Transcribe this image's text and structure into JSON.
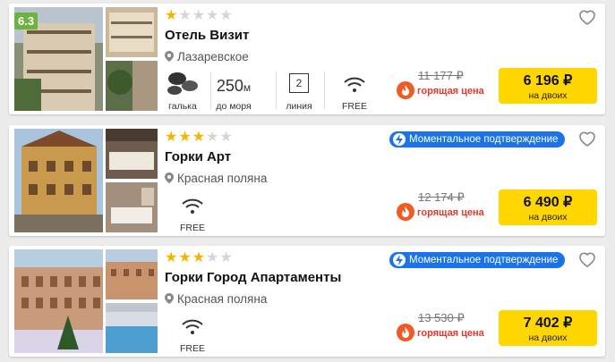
{
  "hotels": [
    {
      "rating_badge": "6.3",
      "stars": 1,
      "name": "Отель Визит",
      "location": "Лазаревское",
      "amenities": {
        "beach": "галька",
        "distance_value": "250",
        "distance_unit": "м",
        "distance_label": "до моря",
        "line_number": "2",
        "line_label": "линия",
        "wifi_label": "FREE"
      },
      "confirm_badge": "",
      "old_price": "11 177 ₽",
      "hot_label": "горящая цена",
      "price": "6 196 ₽",
      "price_sub": "на двоих"
    },
    {
      "rating_badge": "",
      "stars": 3,
      "name": "Горки Арт",
      "location": "Красная поляна",
      "amenities": {
        "wifi_label": "FREE"
      },
      "confirm_badge": "Моментальное подтверждение",
      "old_price": "12 174 ₽",
      "hot_label": "горящая цена",
      "price": "6 490 ₽",
      "price_sub": "на двоих"
    },
    {
      "rating_badge": "",
      "stars": 3,
      "name": "Горки Город Апартаменты",
      "location": "Красная поляна",
      "amenities": {
        "wifi_label": "FREE"
      },
      "confirm_badge": "Моментальное подтверждение",
      "old_price": "13 530 ₽",
      "hot_label": "горящая цена",
      "price": "7 402 ₽",
      "price_sub": "на двоих"
    }
  ],
  "colors": {
    "accent_yellow": "#ffd600",
    "hot_red": "#e4372b",
    "confirm_blue": "#1a73e8",
    "star": "#f5b400",
    "rating_green": "#6cb33f"
  }
}
